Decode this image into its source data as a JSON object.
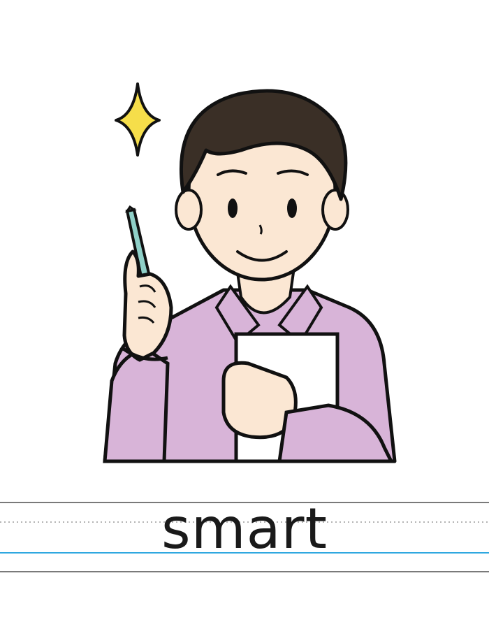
{
  "flashcard": {
    "word": "smart",
    "illustration_subject": "person-with-pen-and-notebook"
  },
  "colors": {
    "shirt": "#d8b4d8",
    "skin": "#fbe7d3",
    "hair": "#3a2f26",
    "sparkle": "#f6de4a",
    "pen": "#8fd0c8",
    "outline": "#111111",
    "guide_blue": "#2fa8e0",
    "guide_gray": "#8a8a8a"
  }
}
